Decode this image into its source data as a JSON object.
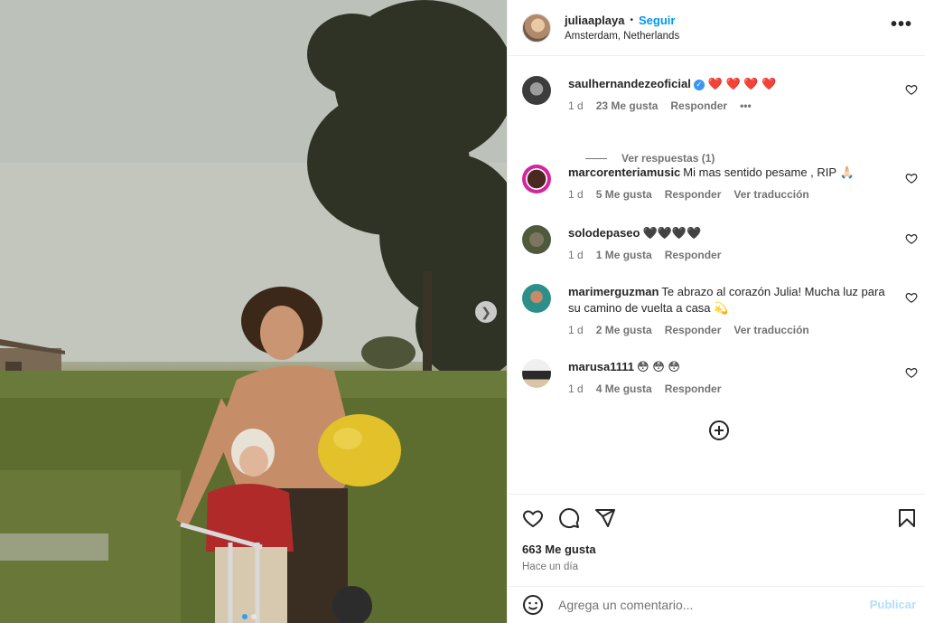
{
  "post": {
    "username": "juliaaplaya",
    "separator": "•",
    "follow_label": "Seguir",
    "location": "Amsterdam, Netherlands",
    "more_icon": "more-horizontal-icon",
    "more_label": "•••"
  },
  "comments": [
    {
      "username": "saulhernandezeoficial",
      "verified": true,
      "text": "❤️ ❤️ ❤️ ❤️",
      "age": "1 d",
      "likes": "23 Me gusta",
      "reply": "Responder",
      "extra": "•••",
      "view_replies": "Ver respuestas (1)"
    },
    {
      "username": "marcorenteriamusic",
      "text": "Mi mas sentido pesame , RIP 🙏🏻",
      "age": "1 d",
      "likes": "5 Me gusta",
      "reply": "Responder",
      "translate": "Ver traducción"
    },
    {
      "username": "solodepaseo",
      "text": "🖤🖤🖤🖤",
      "age": "1 d",
      "likes": "1 Me gusta",
      "reply": "Responder"
    },
    {
      "username": "marimerguzman",
      "text": "Te abrazo al corazón Julia! Mucha luz para su camino de vuelta a casa 💫",
      "age": "1 d",
      "likes": "2 Me gusta",
      "reply": "Responder",
      "translate": "Ver traducción"
    },
    {
      "username": "marusa1111",
      "text": "😳 😳 😳",
      "age": "1 d",
      "likes": "4 Me gusta",
      "reply": "Responder"
    }
  ],
  "actions": {
    "like_icon": "heart-icon",
    "comment_icon": "comment-icon",
    "share_icon": "send-icon",
    "save_icon": "bookmark-icon"
  },
  "likes_count": "663 Me gusta",
  "posted": "Hace un día",
  "composer": {
    "placeholder": "Agrega un comentario...",
    "post_label": "Publicar",
    "emoji_icon": "emoji-icon"
  },
  "carousel": {
    "total": 2,
    "current": 1
  },
  "colors": {
    "accent": "#0095f6",
    "muted": "#737373",
    "heart": "#ed4956"
  }
}
